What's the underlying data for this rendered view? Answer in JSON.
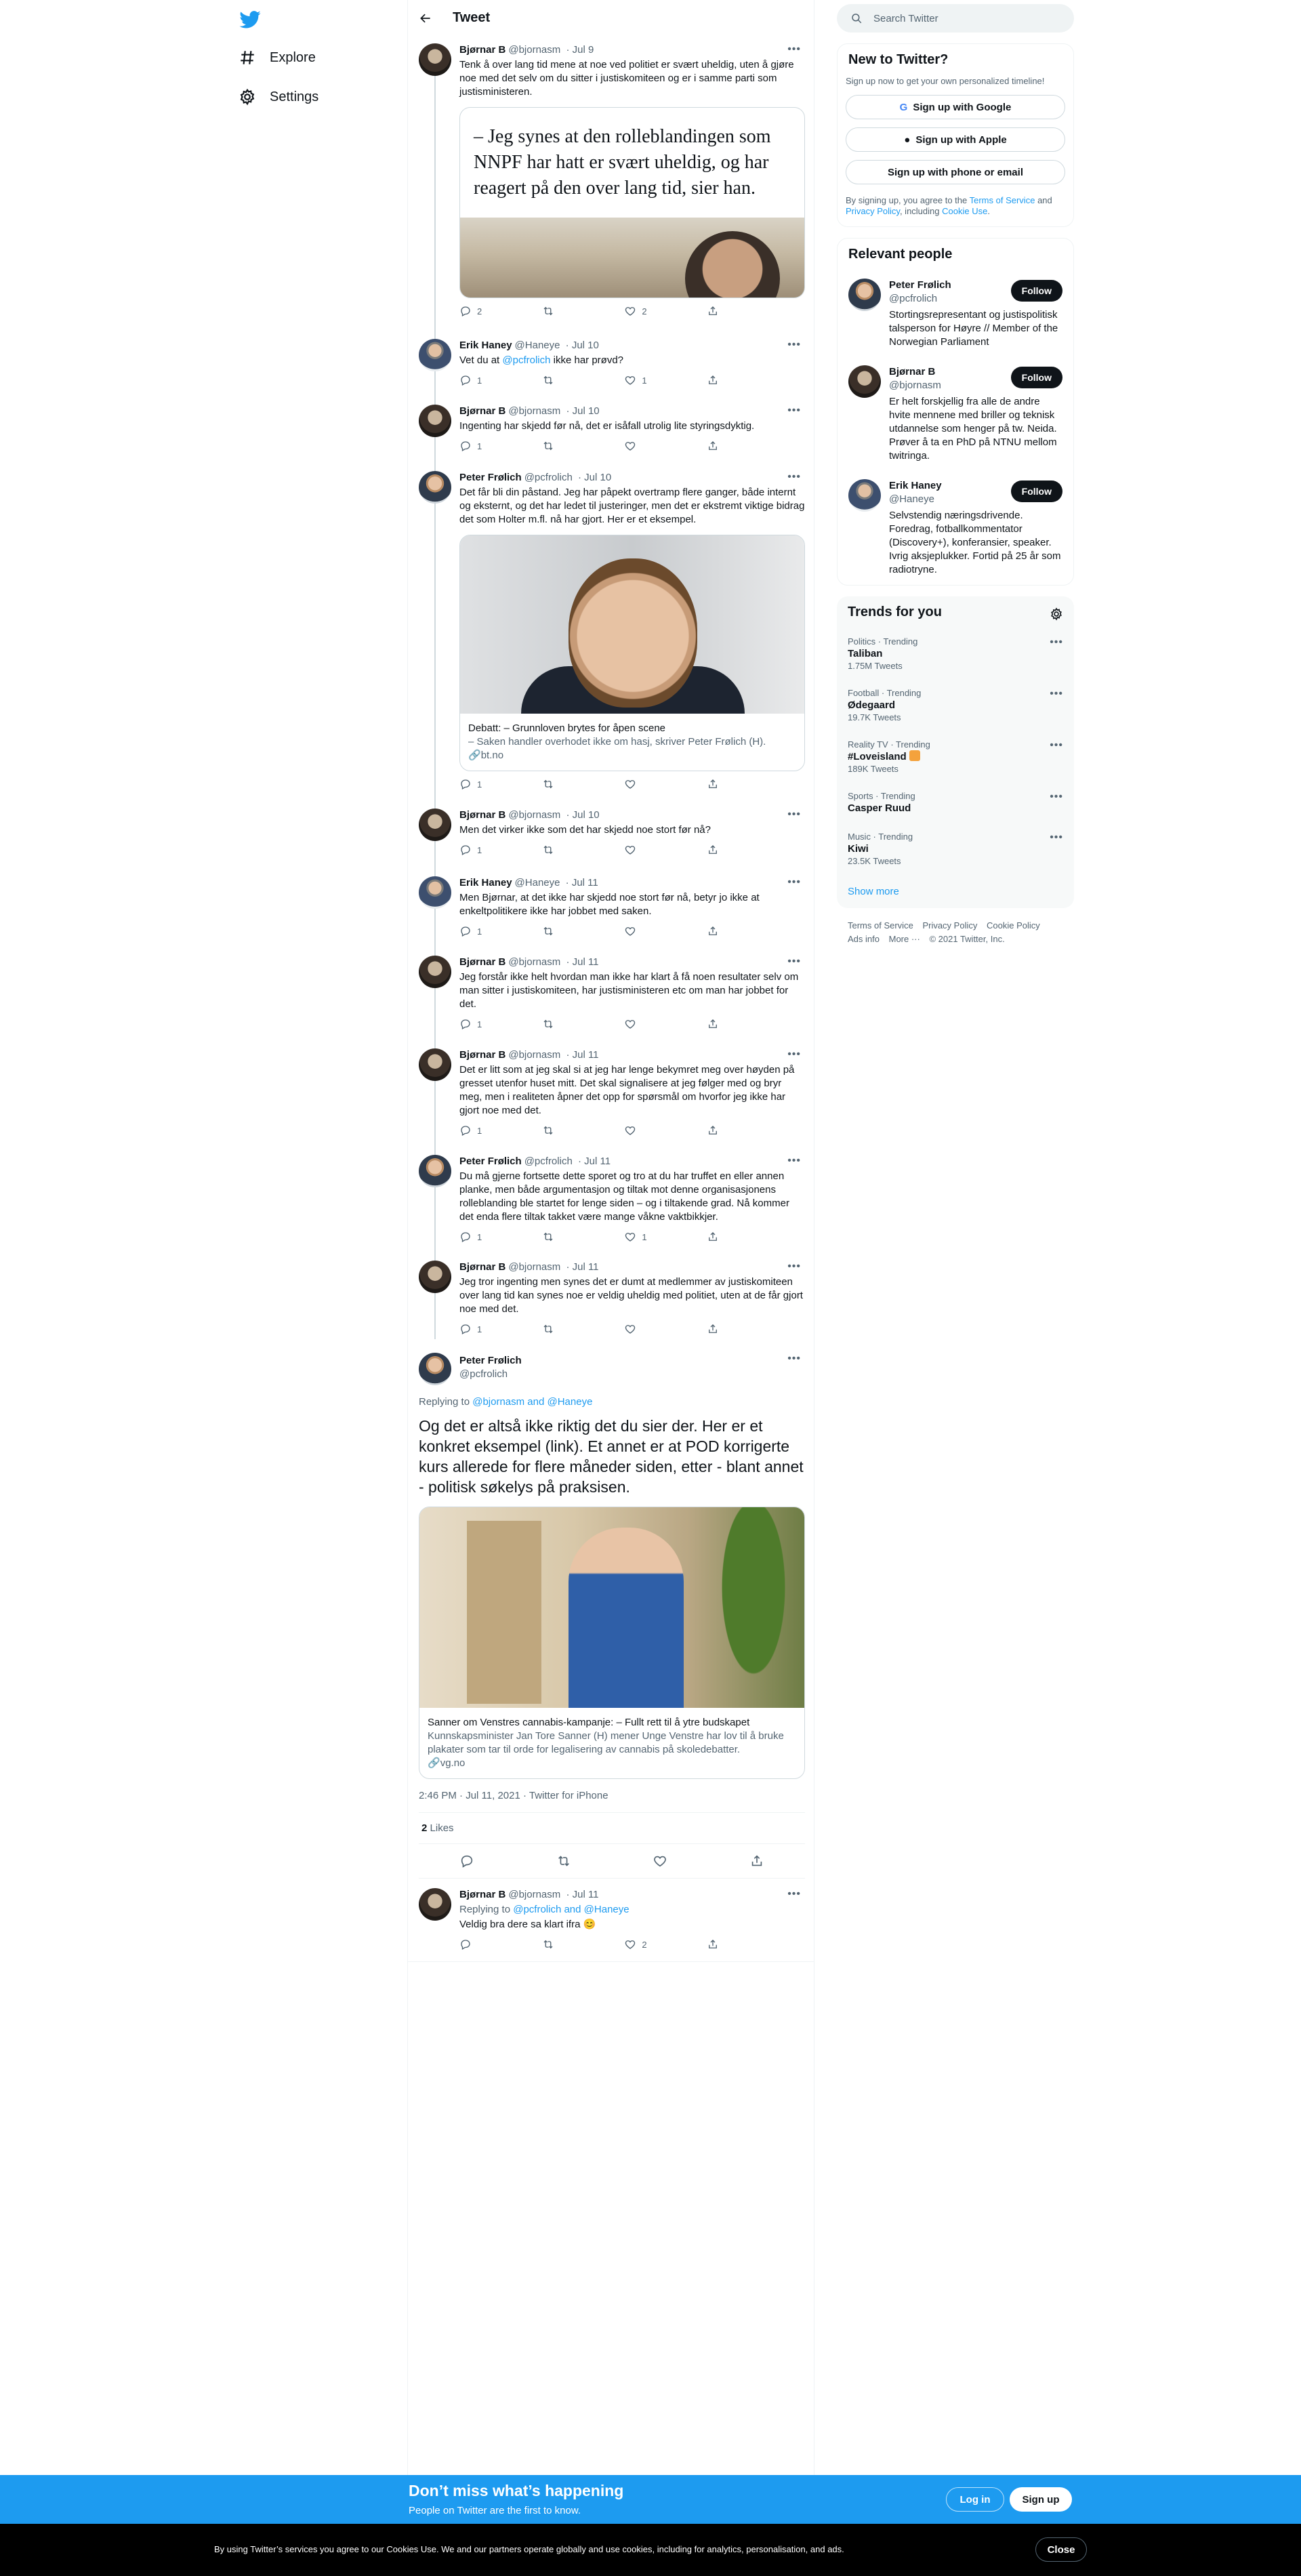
{
  "nav": {
    "explore": "Explore",
    "settings": "Settings"
  },
  "topbar": {
    "title": "Tweet"
  },
  "tweets": [
    {
      "name": "Bjørnar B",
      "handle": "@bjornasm",
      "date": "· Jul 9",
      "text": "Tenk å over lang tid mene at noe ved politiet er svært uheldig, uten å gjøre noe med det selv om du sitter i justiskomiteen og er i samme parti som justisministeren.",
      "quote": "– Jeg synes at den rolleblandingen som NNPF har hatt er svært uheldig, og har reagert på den over lang tid, sier han.",
      "replies": "2",
      "retweets": "",
      "likes": "2"
    },
    {
      "name": "Erik Haney",
      "handle": "@Haneye",
      "date": "· Jul 10",
      "text_pre": "Vet du at ",
      "mention": "@pcfrolich",
      "text_post": " ikke har prøvd?",
      "replies": "1",
      "retweets": "",
      "likes": "1"
    },
    {
      "name": "Bjørnar B",
      "handle": "@bjornasm",
      "date": "· Jul 10",
      "text": "Ingenting har skjedd før nå, det er isåfall utrolig lite styringsdyktig.",
      "replies": "1",
      "retweets": "",
      "likes": ""
    },
    {
      "name": "Peter Frølich",
      "handle": "@pcfrolich",
      "date": "· Jul 10",
      "text": "Det får bli din påstand. Jeg har påpekt overtramp flere ganger, både internt og eksternt, og det har ledet til justeringer, men det er ekstremt viktige bidrag det som Holter m.fl. nå har gjort. Her er et eksempel.",
      "card_title": "Debatt: – Grunnloven brytes for åpen scene",
      "card_desc": "– Saken handler overhodet ikke om hasj, skriver Peter Frølich (H).",
      "card_domain": "bt.no",
      "replies": "1",
      "retweets": "",
      "likes": ""
    },
    {
      "name": "Bjørnar B",
      "handle": "@bjornasm",
      "date": "· Jul 10",
      "text": "Men det virker ikke som det har skjedd noe stort før nå?",
      "replies": "1",
      "retweets": "",
      "likes": ""
    },
    {
      "name": "Erik Haney",
      "handle": "@Haneye",
      "date": "· Jul 11",
      "text": "Men Bjørnar, at det ikke har skjedd noe stort før nå, betyr jo ikke at enkeltpolitikere ikke har jobbet med saken.",
      "replies": "1",
      "retweets": "",
      "likes": ""
    },
    {
      "name": "Bjørnar B",
      "handle": "@bjornasm",
      "date": "· Jul 11",
      "text": "Jeg forstår ikke helt hvordan man ikke har klart å få noen resultater selv om man sitter i justiskomiteen, har justisministeren etc om man har jobbet for det.",
      "replies": "1",
      "retweets": "",
      "likes": ""
    },
    {
      "name": "Bjørnar B",
      "handle": "@bjornasm",
      "date": "· Jul 11",
      "text": "Det er litt som at jeg skal si at jeg har lenge bekymret meg over høyden på gresset utenfor huset mitt. Det skal signalisere at jeg følger med og bryr meg, men i realiteten åpner det opp for spørsmål om hvorfor jeg ikke har gjort noe med det.",
      "replies": "1",
      "retweets": "",
      "likes": ""
    },
    {
      "name": "Peter Frølich",
      "handle": "@pcfrolich",
      "date": "· Jul 11",
      "text": "Du må gjerne fortsette dette sporet og tro at du har truffet en eller annen planke, men både argumentasjon og tiltak mot denne organisasjonens rolleblanding ble startet for lenge siden – og i tiltakende grad. Nå kommer det enda flere tiltak takket være mange våkne vaktbikkjer.",
      "replies": "1",
      "retweets": "",
      "likes": "1"
    },
    {
      "name": "Bjørnar B",
      "handle": "@bjornasm",
      "date": "· Jul 11",
      "text": "Jeg tror ingenting men synes det er dumt at medlemmer av justiskomiteen over lang tid kan synes noe er veldig uheldig med politiet, uten at de får gjort noe med det.",
      "replies": "1",
      "retweets": "",
      "likes": ""
    }
  ],
  "focus": {
    "name": "Peter Frølich",
    "handle": "@pcfrolich",
    "replying_label": "Replying to",
    "replying_to": "@bjornasm and @Haneye",
    "text": "Og det er altså ikke riktig det du sier der. Her er et konkret eksempel (link). Et annet er at POD korrigerte kurs allerede for flere måneder siden, etter - blant annet - politisk søkelys på praksisen.",
    "card_title": "Sanner om Venstres cannabis-kampanje: – Fullt rett til å ytre budskapet",
    "card_desc": "Kunnskapsminister Jan Tore Sanner (H) mener Unge Venstre har lov til å bruke plakater som tar til orde for legalisering av cannabis på skoledebatter.",
    "card_domain": "vg.no",
    "timestamp": "2:46 PM · Jul 11, 2021 · Twitter for iPhone",
    "likes_count": "2",
    "likes_label": "Likes"
  },
  "reply": {
    "name": "Bjørnar B",
    "handle": "@bjornasm",
    "date": "· Jul 11",
    "replying_label": "Replying to",
    "replying_to": "@pcfrolich and @Haneye",
    "text": "Veldig bra dere sa klart ifra 😊",
    "replies": "",
    "retweets": "",
    "likes": "2"
  },
  "right": {
    "search_placeholder": "Search Twitter",
    "new_title": "New to Twitter?",
    "new_sub": "Sign up now to get your own personalized timeline!",
    "btn_google": "Sign up with Google",
    "btn_apple": "Sign up with Apple",
    "btn_phone": "Sign up with phone or email",
    "terms_pre": "By signing up, you agree to the",
    "terms_link": "Terms of Service",
    "terms_and": "and",
    "privacy_link": "Privacy Policy",
    "terms_inc": ", including",
    "cookie_link": "Cookie Use",
    "terms_end": ".",
    "relevant_title": "Relevant people",
    "follow_label": "Follow",
    "people": [
      {
        "name": "Peter Frølich",
        "handle": "@pcfrolich",
        "bio": "Stortingsrepresentant og justispolitisk talsperson for Høyre // Member of the Norwegian Parliament"
      },
      {
        "name": "Bjørnar B",
        "handle": "@bjornasm",
        "bio": "Er helt forskjellig fra alle de andre hvite mennene med briller og teknisk utdannelse som henger på tw. Neida. Prøver å ta en PhD på NTNU mellom twitringa."
      },
      {
        "name": "Erik Haney",
        "handle": "@Haneye",
        "bio": "Selvstendig næringsdrivende. Foredrag, fotballkommentator (Discovery+), konferansier, speaker. Ivrig aksjeplukker. Fortid på 25 år som radiotryne."
      }
    ],
    "trends_title": "Trends for you",
    "trends": [
      {
        "cat": "Politics · Trending",
        "name": "Taliban",
        "count": "1.75M Tweets"
      },
      {
        "cat": "Football · Trending",
        "name": "Ødegaard",
        "count": "19.7K Tweets"
      },
      {
        "cat": "Reality TV · Trending",
        "name": "#Loveisland",
        "count": "189K Tweets"
      },
      {
        "cat": "Sports · Trending",
        "name": "Casper Ruud",
        "count": ""
      },
      {
        "cat": "Music · Trending",
        "name": "Kiwi",
        "count": "23.5K Tweets"
      }
    ],
    "show_more": "Show more",
    "footer": [
      "Terms of Service",
      "Privacy Policy",
      "Cookie Policy",
      "Ads info",
      "More ···",
      "© 2021 Twitter, Inc."
    ]
  },
  "signup_bar": {
    "title": "Don’t miss what’s happening",
    "sub": "People on Twitter are the first to know.",
    "login": "Log in",
    "signup": "Sign up"
  },
  "cookie_bar": {
    "text": "By using Twitter’s services you agree to our Cookies Use. We and our partners operate globally and use cookies, including for analytics, personalisation, and ads.",
    "close": "Close"
  },
  "colors": {
    "accent": "#1d9bf0",
    "text": "#0f1419",
    "muted": "#536471"
  }
}
